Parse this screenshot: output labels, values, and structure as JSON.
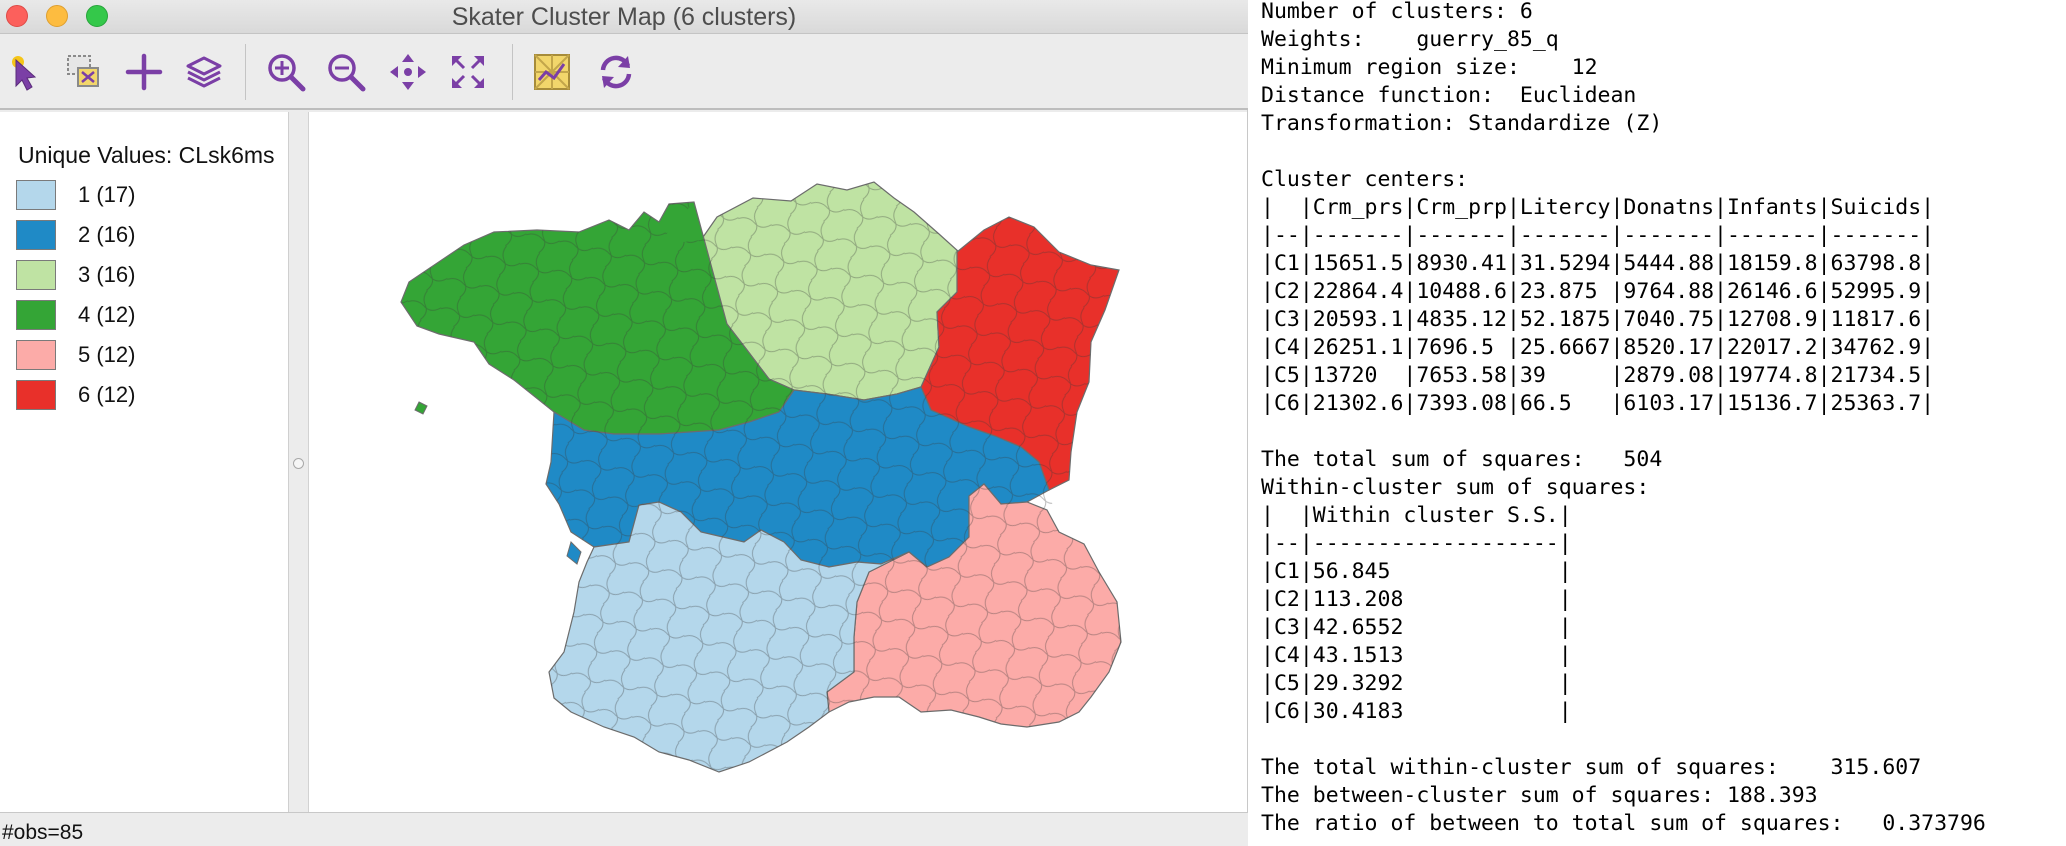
{
  "window": {
    "title": "Skater Cluster Map (6 clusters)"
  },
  "toolbar": {
    "tools": [
      {
        "name": "select-pointer-icon",
        "label": ""
      },
      {
        "name": "selection-shape-icon",
        "label": ""
      },
      {
        "name": "plus-icon",
        "label": ""
      },
      {
        "name": "layers-icon",
        "label": ""
      },
      {
        "name": "zoom-in-icon",
        "label": ""
      },
      {
        "name": "zoom-out-icon",
        "label": ""
      },
      {
        "name": "pan-icon",
        "label": ""
      },
      {
        "name": "full-extent-icon",
        "label": ""
      },
      {
        "name": "basemap-icon",
        "label": ""
      },
      {
        "name": "refresh-icon",
        "label": ""
      }
    ],
    "accent_color": "#7b3fa6"
  },
  "legend": {
    "title": "Unique Values: CLsk6ms",
    "items": [
      {
        "label": "1 (17)",
        "color": "#b4d7eb",
        "count": 17
      },
      {
        "label": "2 (16)",
        "color": "#1f8ac6",
        "count": 16
      },
      {
        "label": "3 (16)",
        "color": "#bfe3a3",
        "count": 16
      },
      {
        "label": "4 (12)",
        "color": "#34a536",
        "count": 12
      },
      {
        "label": "5 (12)",
        "color": "#fcaba8",
        "count": 12
      },
      {
        "label": "6 (12)",
        "color": "#e8302a",
        "count": 12
      }
    ]
  },
  "status": {
    "text": "#obs=85"
  },
  "summary": {
    "lines": [
      "Number of clusters: 6",
      "Weights:    guerry_85_q",
      "Minimum region size:    12",
      "Distance function:  Euclidean",
      "Transformation: Standardize (Z)",
      "",
      "Cluster centers:",
      "|  |Crm_prs|Crm_prp|Litercy|Donatns|Infants|Suicids|",
      "|--|-------|-------|-------|-------|-------|-------|",
      "|C1|15651.5|8930.41|31.5294|5444.88|18159.8|63798.8|",
      "|C2|22864.4|10488.6|23.875 |9764.88|26146.6|52995.9|",
      "|C3|20593.1|4835.12|52.1875|7040.75|12708.9|11817.6|",
      "|C4|26251.1|7696.5 |25.6667|8520.17|22017.2|34762.9|",
      "|C5|13720  |7653.58|39     |2879.08|19774.8|21734.5|",
      "|C6|21302.6|7393.08|66.5   |6103.17|15136.7|25363.7|",
      "",
      "The total sum of squares:   504",
      "Within-cluster sum of squares:",
      "|  |Within cluster S.S.|",
      "|--|-------------------|",
      "|C1|56.845             |",
      "|C2|113.208            |",
      "|C3|42.6552            |",
      "|C4|43.1513            |",
      "|C5|29.3292            |",
      "|C6|30.4183            |",
      "",
      "The total within-cluster sum of squares:    315.607",
      "The between-cluster sum of squares: 188.393",
      "The ratio of between to total sum of squares:   0.373796"
    ]
  }
}
